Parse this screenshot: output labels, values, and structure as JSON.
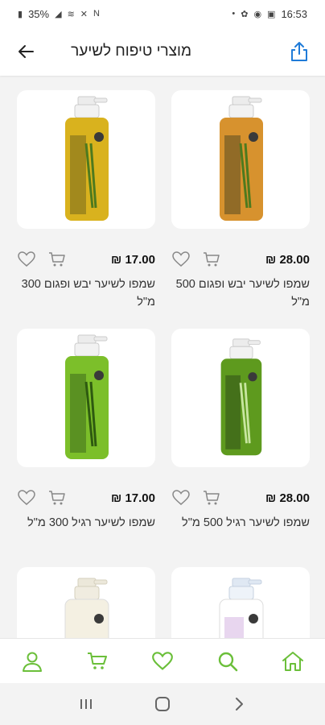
{
  "status_bar": {
    "battery": "35%",
    "time": "16:53"
  },
  "header": {
    "title": "מוצרי טיפוח לשיער",
    "back_icon": "arrow-left-icon",
    "share_icon": "share-icon"
  },
  "accent_color": "#6bbf3a",
  "currency": "₪",
  "products": [
    {
      "name": "שמפו לשיער יבש ופגום 500 מ\"ל",
      "price": "28.00 ₪",
      "liquid": "#d7922e"
    },
    {
      "name": "שמפו לשיער יבש ופגום 300 מ\"ל",
      "price": "17.00 ₪",
      "liquid": "#d9b21e"
    },
    {
      "name": "שמפו לשיער רגיל 500 מ\"ל",
      "price": "28.00 ₪",
      "liquid": "#5e9a1e"
    },
    {
      "name": "שמפו לשיער רגיל 300 מ\"ל",
      "price": "17.00 ₪",
      "liquid": "#7cbf2a"
    },
    {
      "name": "",
      "price": "",
      "liquid": "#ffffff"
    },
    {
      "name": "",
      "price": "",
      "liquid": "#f4f0e2"
    }
  ],
  "bottom_nav": [
    "home-icon",
    "search-icon",
    "heart-icon",
    "cart-icon",
    "user-icon"
  ]
}
